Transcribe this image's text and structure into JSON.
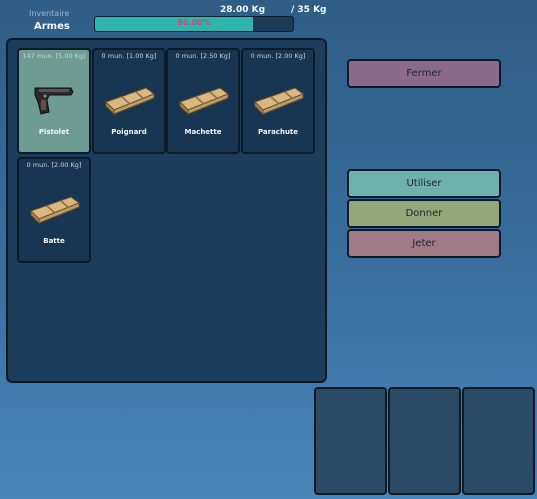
{
  "header": {
    "subtitle": "Inventaire",
    "title": "Armes",
    "weight": "28.00 Kg",
    "max_weight": "/ 35 Kg",
    "load_percent_text": "80.00%",
    "load_fraction": 0.8
  },
  "items": [
    {
      "ammo": "147 mun. [5.00 Kg]",
      "name": "Pistolet",
      "icon": "pistol-icon",
      "selected": true
    },
    {
      "ammo": "0 mun. [1.00 Kg]",
      "name": "Poignard",
      "icon": "weapon-crate-icon",
      "selected": false
    },
    {
      "ammo": "0 mun. [2.50 Kg]",
      "name": "Machette",
      "icon": "weapon-crate-icon",
      "selected": false
    },
    {
      "ammo": "0 mun. [2.00 Kg]",
      "name": "Parachute",
      "icon": "weapon-crate-icon",
      "selected": false
    },
    {
      "ammo": "0 mun. [2.00 Kg]",
      "name": "Batte",
      "icon": "weapon-crate-icon",
      "selected": false
    }
  ],
  "actions": {
    "close": "Fermer",
    "use": "Utiliser",
    "give": "Donner",
    "drop": "Jeter"
  },
  "colors": {
    "accent": "#2fb5ae",
    "close_button": "#8b6a8d",
    "use_button": "#6fb1ae",
    "give_button": "#94a77a",
    "drop_button": "#a07a85"
  }
}
